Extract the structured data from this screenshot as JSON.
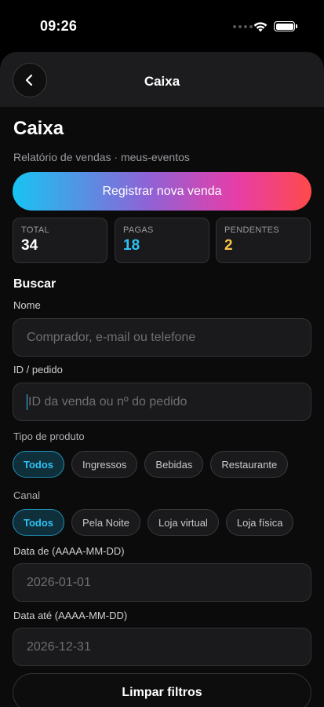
{
  "status_bar": {
    "time": "09:26"
  },
  "header": {
    "title": "Caixa"
  },
  "page": {
    "title": "Caixa",
    "subtitle": "Relatório de vendas · meus-eventos"
  },
  "actions": {
    "register_sale": "Registrar nova venda",
    "clear_filters": "Limpar filtros"
  },
  "stats": [
    {
      "label": "TOTAL",
      "value": "34",
      "color": "#ffffff"
    },
    {
      "label": "PAGAS",
      "value": "18",
      "color": "#2ec3f5"
    },
    {
      "label": "PENDENTES",
      "value": "2",
      "color": "#f7c548"
    }
  ],
  "search": {
    "title": "Buscar",
    "name_label": "Nome",
    "name_placeholder": "Comprador, e-mail ou telefone",
    "id_label": "ID / pedido",
    "id_placeholder": "ID da venda ou nº do pedido",
    "product_type_label": "Tipo de produto",
    "product_types": [
      "Todos",
      "Ingressos",
      "Bebidas",
      "Restaurante"
    ],
    "channel_label": "Canal",
    "channels": [
      "Todos",
      "Pela Noite",
      "Loja virtual",
      "Loja física"
    ],
    "date_from_label": "Data de (AAAA-MM-DD)",
    "date_from_value": "2026-01-01",
    "date_to_label": "Data até (AAAA-MM-DD)",
    "date_to_value": "2026-12-31"
  },
  "accent_colors": {
    "gradient_start": "#18c4f2",
    "gradient_end": "#ff4a4a",
    "active_chip": "#2ec3f5"
  }
}
